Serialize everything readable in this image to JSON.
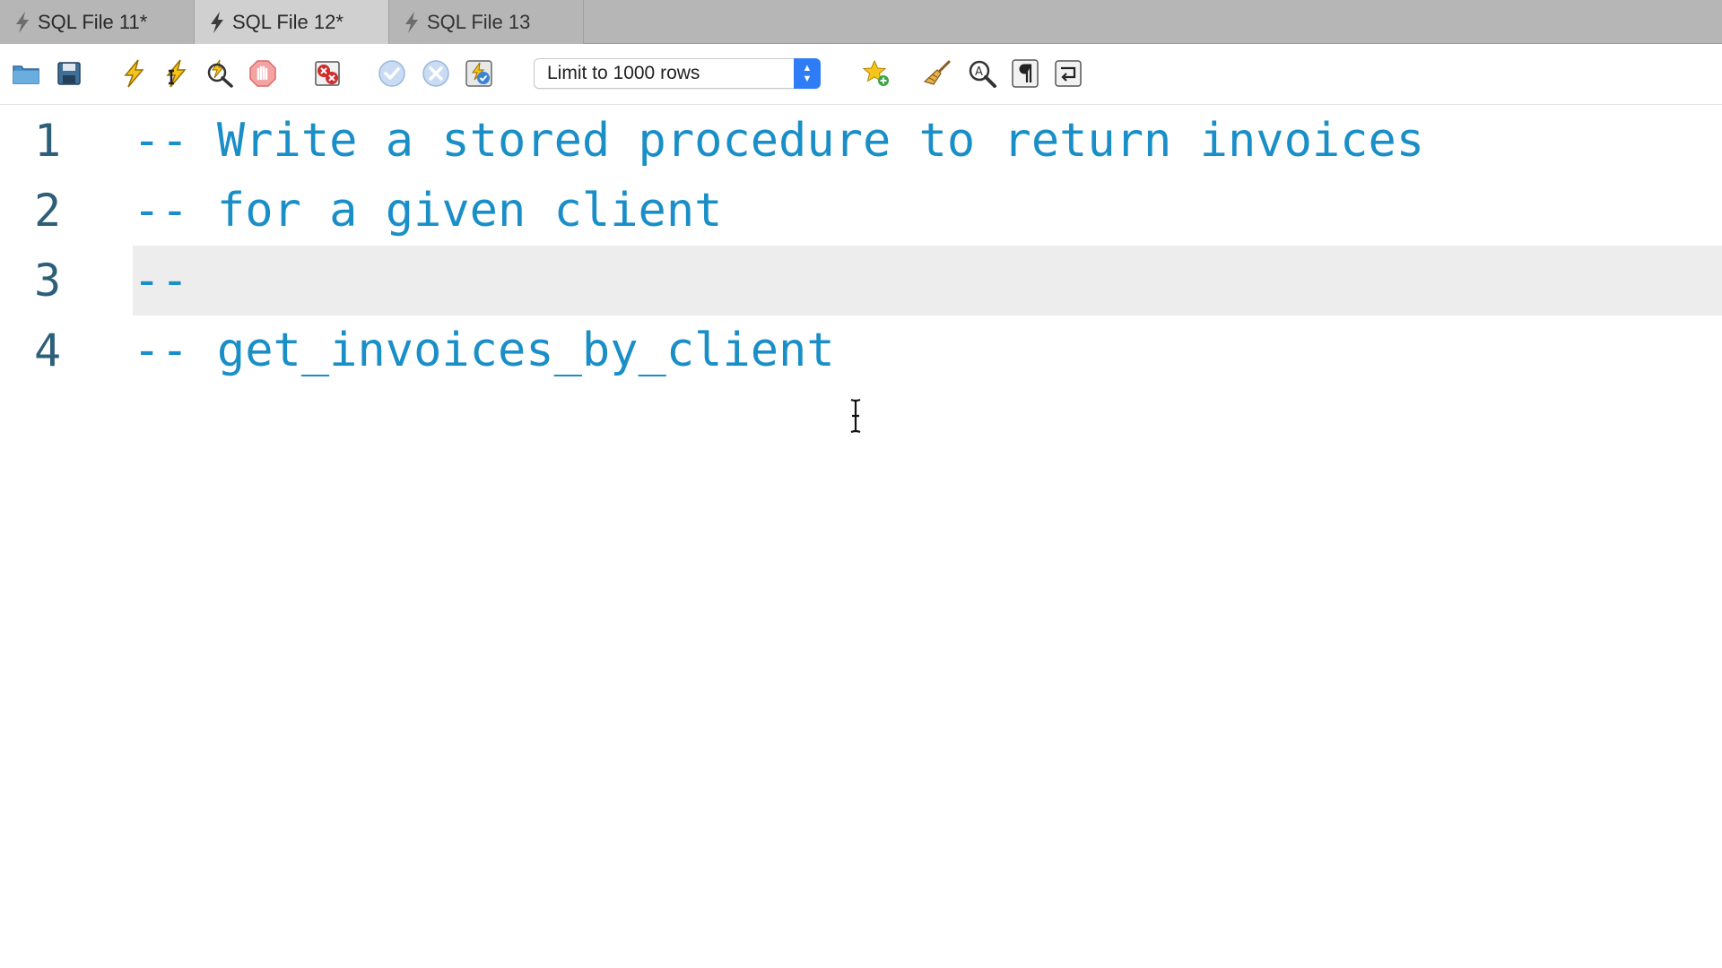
{
  "tabs": [
    {
      "label": "SQL File 11*",
      "active": false
    },
    {
      "label": "SQL File 12*",
      "active": true
    },
    {
      "label": "SQL File 13",
      "active": false
    }
  ],
  "toolbar": {
    "limit_select": {
      "value": "Limit to 1000 rows"
    },
    "icons": [
      "open-folder-icon",
      "save-icon",
      "execute-icon",
      "execute-current-icon",
      "explain-icon",
      "stop-icon",
      "toggle-error-icon",
      "commit-icon",
      "rollback-icon",
      "autocommit-icon",
      "add-snippet-icon",
      "beautify-icon",
      "find-icon",
      "invisible-chars-icon",
      "word-wrap-icon"
    ]
  },
  "editor": {
    "lines": [
      {
        "number": "1",
        "code": "-- Write a stored procedure to return invoices"
      },
      {
        "number": "2",
        "code": "-- for a given client"
      },
      {
        "number": "3",
        "code": "--"
      },
      {
        "number": "4",
        "code": "-- get_invoices_by_client"
      }
    ],
    "current_line": 3
  },
  "colors": {
    "comment": "#1a8fc7",
    "line_number": "#2d5f7a",
    "current_line_bg": "#ededed",
    "tabbar_bg": "#b6b6b6",
    "select_accent": "#2f7df6"
  }
}
